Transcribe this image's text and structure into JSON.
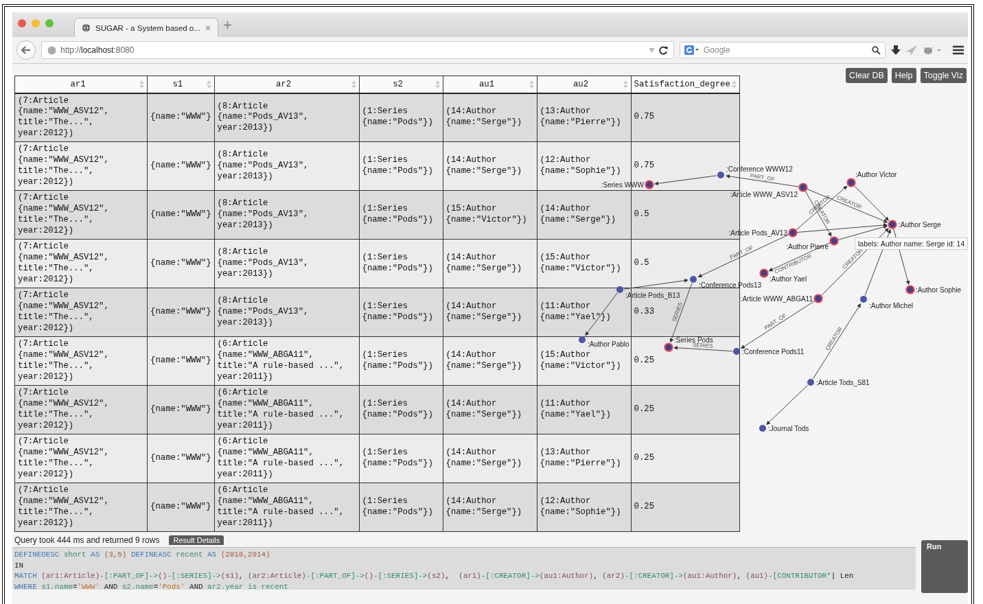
{
  "browser": {
    "tab_title": "SUGAR - a System based o...",
    "url": "http://**localhost**:8080",
    "search": {
      "placeholder": "Google"
    }
  },
  "toolbar_buttons": [
    "Clear DB",
    "Help",
    "Toggle Viz"
  ],
  "table": {
    "columns": [
      "ar1",
      "s1",
      "ar2",
      "s2",
      "au1",
      "au2",
      "Satisfaction_degree"
    ],
    "rows": [
      [
        "(7:Article\n{name:\"WWW_ASV12\",\ntitle:\"The...\",\nyear:2012})",
        "{name:\"WWW\"}",
        "(8:Article\n{name:\"Pods_AV13\",\nyear:2013})",
        "(1:Series\n{name:\"Pods\"})",
        "(14:Author\n{name:\"Serge\"})",
        "(13:Author\n{name:\"Pierre\"})",
        "0.75"
      ],
      [
        "(7:Article\n{name:\"WWW_ASV12\",\ntitle:\"The...\",\nyear:2012})",
        "{name:\"WWW\"}",
        "(8:Article\n{name:\"Pods_AV13\",\nyear:2013})",
        "(1:Series\n{name:\"Pods\"})",
        "(14:Author\n{name:\"Serge\"})",
        "(12:Author\n{name:\"Sophie\"})",
        "0.75"
      ],
      [
        "(7:Article\n{name:\"WWW_ASV12\",\ntitle:\"The...\",\nyear:2012})",
        "{name:\"WWW\"}",
        "(8:Article\n{name:\"Pods_AV13\",\nyear:2013})",
        "(1:Series\n{name:\"Pods\"})",
        "(15:Author\n{name:\"Victor\"})",
        "(14:Author\n{name:\"Serge\"})",
        "0.5"
      ],
      [
        "(7:Article\n{name:\"WWW_ASV12\",\ntitle:\"The...\",\nyear:2012})",
        "{name:\"WWW\"}",
        "(8:Article\n{name:\"Pods_AV13\",\nyear:2013})",
        "(1:Series\n{name:\"Pods\"})",
        "(14:Author\n{name:\"Serge\"})",
        "(15:Author\n{name:\"Victor\"})",
        "0.5"
      ],
      [
        "(7:Article\n{name:\"WWW_ASV12\",\ntitle:\"The...\",\nyear:2012})",
        "{name:\"WWW\"}",
        "(8:Article\n{name:\"Pods_AV13\",\nyear:2013})",
        "(1:Series\n{name:\"Pods\"})",
        "(14:Author\n{name:\"Serge\"})",
        "(11:Author\n{name:\"Yael\"})",
        "0.33"
      ],
      [
        "(7:Article\n{name:\"WWW_ASV12\",\ntitle:\"The...\",\nyear:2012})",
        "{name:\"WWW\"}",
        "(6:Article\n{name:\"WWW_ABGA11\",\ntitle:\"A rule-based ...\",\nyear:2011})",
        "(1:Series\n{name:\"Pods\"})",
        "(14:Author\n{name:\"Serge\"})",
        "(15:Author\n{name:\"Victor\"})",
        "0.25"
      ],
      [
        "(7:Article\n{name:\"WWW_ASV12\",\ntitle:\"The...\",\nyear:2012})",
        "{name:\"WWW\"}",
        "(6:Article\n{name:\"WWW_ABGA11\",\ntitle:\"A rule-based ...\",\nyear:2011})",
        "(1:Series\n{name:\"Pods\"})",
        "(14:Author\n{name:\"Serge\"})",
        "(11:Author\n{name:\"Yael\"})",
        "0.25"
      ],
      [
        "(7:Article\n{name:\"WWW_ASV12\",\ntitle:\"The...\",\nyear:2012})",
        "{name:\"WWW\"}",
        "(6:Article\n{name:\"WWW_ABGA11\",\ntitle:\"A rule-based ...\",\nyear:2011})",
        "(1:Series\n{name:\"Pods\"})",
        "(14:Author\n{name:\"Serge\"})",
        "(13:Author\n{name:\"Pierre\"})",
        "0.25"
      ],
      [
        "(7:Article\n{name:\"WWW_ASV12\",\ntitle:\"The...\",\nyear:2012})",
        "{name:\"WWW\"}",
        "(6:Article\n{name:\"WWW_ABGA11\",\ntitle:\"A rule-based ...\",\nyear:2011})",
        "(1:Series\n{name:\"Pods\"})",
        "(14:Author\n{name:\"Serge\"})",
        "(12:Author\n{name:\"Sophie\"})",
        "0.25"
      ]
    ]
  },
  "graph": {
    "nodes": [
      {
        "label": ":Conference WWW12",
        "kind": "plain"
      },
      {
        "label": ":Author Victor",
        "kind": "highlighted"
      },
      {
        "label": ":Series WWW",
        "kind": "highlighted"
      },
      {
        "label": ":Article WWW_ASV12",
        "kind": "highlighted"
      },
      {
        "label": ":Author Serge",
        "kind": "highlighted"
      },
      {
        "label": ":Article Pods_AV13",
        "kind": "highlighted"
      },
      {
        "label": ":Author Pierre",
        "kind": "highlighted"
      },
      {
        "label": ":Author Yael",
        "kind": "highlighted"
      },
      {
        "label": ":Conference Pods13",
        "kind": "plain"
      },
      {
        "label": ":Article Pods_B13",
        "kind": "plain"
      },
      {
        "label": ":Author Sophie",
        "kind": "highlighted"
      },
      {
        "label": ":Article WWW_ABGA11",
        "kind": "highlighted"
      },
      {
        "label": ":Author Michel",
        "kind": "plain"
      },
      {
        "label": ":Author Pablo",
        "kind": "plain"
      },
      {
        "label": ":Series Pods",
        "kind": "highlighted"
      },
      {
        "label": ":Conference Pods11",
        "kind": "plain"
      },
      {
        "label": ":Article Tods_S81",
        "kind": "plain"
      },
      {
        "label": ":Journal Tods",
        "kind": "plain"
      }
    ],
    "edges": [
      {
        "label": "PART_OF"
      },
      {
        "label": "CREATOR"
      },
      {
        "label": "CREATOR"
      },
      {
        "label": "CREATOR"
      },
      {
        "label": "PART_OF"
      },
      {
        "label": "CONTRIBUTOR"
      },
      {
        "label": "SERIES"
      },
      {
        "label": "SERIES"
      },
      {
        "label": "PART_OF"
      },
      {
        "label": "CREATOR"
      },
      {
        "label": "CREATOR"
      }
    ],
    "tooltip": "labels: Author name: Serge id: 14"
  },
  "status": "Query took 444 ms and returned 9 rows",
  "result_details_button": "Result Details",
  "query": {
    "lines": [
      [
        {
          "text": "DEFINEDESC ",
          "kind": "keyword"
        },
        {
          "text": "short ",
          "kind": "ident"
        },
        {
          "text": "AS ",
          "kind": "keyword"
        },
        {
          "text": "(3,5) ",
          "kind": "number"
        },
        {
          "text": "DEFINEASC ",
          "kind": "keyword"
        },
        {
          "text": "recent ",
          "kind": "ident"
        },
        {
          "text": "AS ",
          "kind": "keyword"
        },
        {
          "text": "(2010,2014)",
          "kind": "number"
        }
      ],
      [
        {
          "text": "IN",
          "kind": "plain"
        }
      ],
      [
        {
          "text": "MATCH ",
          "kind": "keyword"
        },
        {
          "text": "(ar1:Article)",
          "kind": "node"
        },
        {
          "text": "-[:PART_OF]->",
          "kind": "rel"
        },
        {
          "text": "()",
          "kind": "node"
        },
        {
          "text": "-[:SERIES]->",
          "kind": "rel"
        },
        {
          "text": "(s1)",
          "kind": "node"
        },
        {
          "text": ", ",
          "kind": "plain"
        },
        {
          "text": "(ar2:Article)",
          "kind": "node"
        },
        {
          "text": "-[:PART_OF]->",
          "kind": "rel"
        },
        {
          "text": "()",
          "kind": "node"
        },
        {
          "text": "-[:SERIES]->",
          "kind": "rel"
        },
        {
          "text": "(s2)",
          "kind": "node"
        },
        {
          "text": ",  ",
          "kind": "plain"
        },
        {
          "text": "(ar1)",
          "kind": "node"
        },
        {
          "text": "-[:CREATOR]->",
          "kind": "rel"
        },
        {
          "text": "(au1:Author)",
          "kind": "node"
        },
        {
          "text": ", ",
          "kind": "plain"
        },
        {
          "text": "(ar2)",
          "kind": "node"
        },
        {
          "text": "-[:CREATOR]->",
          "kind": "rel"
        },
        {
          "text": "(au1:Author)",
          "kind": "node"
        },
        {
          "text": ", ",
          "kind": "plain"
        },
        {
          "text": "(au1)",
          "kind": "node"
        },
        {
          "text": "-[CONTRIBUTOR*",
          "kind": "rel"
        },
        {
          "text": "| Len",
          "kind": "plain"
        }
      ],
      [
        {
          "text": "WHERE ",
          "kind": "keyword"
        },
        {
          "text": "s1.name",
          "kind": "ident"
        },
        {
          "text": "=",
          "kind": "plain"
        },
        {
          "text": "'WWW'",
          "kind": "string"
        },
        {
          "text": " AND ",
          "kind": "plain"
        },
        {
          "text": "s2.name",
          "kind": "ident"
        },
        {
          "text": "=",
          "kind": "plain"
        },
        {
          "text": "'Pods'",
          "kind": "string"
        },
        {
          "text": " AND ",
          "kind": "plain"
        },
        {
          "text": "ar2.year is recent",
          "kind": "ident"
        }
      ]
    ]
  },
  "run_button": "Run"
}
